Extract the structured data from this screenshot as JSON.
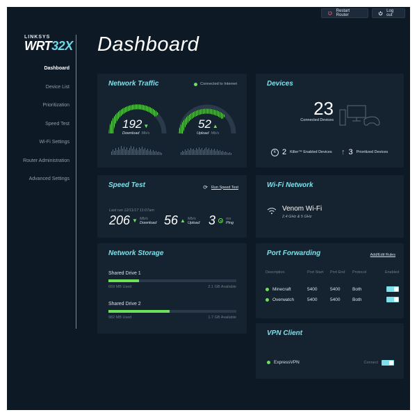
{
  "topbar": {
    "restart_label": "Restart Router",
    "logout_label": "Log out"
  },
  "brand": {
    "maker": "LINKSYS",
    "model_main": "WRT",
    "model_accent": "32X"
  },
  "sidebar": {
    "items": [
      {
        "label": "Dashboard",
        "active": true
      },
      {
        "label": "Device List",
        "active": false
      },
      {
        "label": "Prioritization",
        "active": false
      },
      {
        "label": "Speed Test",
        "active": false
      },
      {
        "label": "Wi-Fi Settings",
        "active": false
      },
      {
        "label": "Router Administration",
        "active": false
      },
      {
        "label": "Advanced Settings",
        "active": false
      }
    ]
  },
  "page_title": "Dashboard",
  "network_traffic": {
    "title": "Network Traffic",
    "status": "Connected to Internet",
    "download_value": "192",
    "download_label": "Download",
    "download_unit": "Mb/s",
    "upload_value": "52",
    "upload_label": "Upload",
    "upload_unit": "Mb/s"
  },
  "devices": {
    "title": "Devices",
    "connected_count": "23",
    "connected_label": "Connected Devices",
    "killer_count": "2",
    "killer_label": "Killer™ Enabled Devices",
    "prioritized_count": "3",
    "prioritized_label": "Prioritized Devices"
  },
  "speed_test": {
    "title": "Speed Test",
    "run_label": "Run Speed Test",
    "last_run": "Last run 12/11/17 11:07am",
    "download_value": "206",
    "download_unit": "Mb/s",
    "download_label": "Download",
    "upload_value": "56",
    "upload_unit": "Mb/s",
    "upload_label": "Upload",
    "ping_value": "3",
    "ping_unit": "ms",
    "ping_label": "Ping"
  },
  "wifi": {
    "title": "Wi-Fi Network",
    "ssid": "Venom Wi-Fi",
    "bands": "2.4 GHz & 5 GHz"
  },
  "storage": {
    "title": "Network Storage",
    "drives": [
      {
        "name": "Shared Drive 1",
        "used": "669 MB Used",
        "available": "2.1 GB Available",
        "fill": 0.24
      },
      {
        "name": "Shared Drive 2",
        "used": "982 MB Used",
        "available": "1.7 GB Available",
        "fill": 0.48
      }
    ]
  },
  "port_forwarding": {
    "title": "Port Forwarding",
    "add_edit_label": "Add/Edit Rules",
    "headers": [
      "Description",
      "Port Start",
      "Port End",
      "Protocol",
      "Enabled"
    ],
    "rows": [
      {
        "description": "Minecraft",
        "port_start": "5400",
        "port_end": "5400",
        "protocol": "Both",
        "enabled": true
      },
      {
        "description": "Overwatch",
        "port_start": "5400",
        "port_end": "5400",
        "protocol": "Both",
        "enabled": true
      }
    ]
  },
  "vpn": {
    "title": "VPN Client",
    "name": "ExpressVPN",
    "connect_label": "Connect",
    "enabled": true
  },
  "colors": {
    "background": "#0e1926",
    "card": "#15222f",
    "accent": "#7fe0ea",
    "green": "#6ee05a"
  }
}
